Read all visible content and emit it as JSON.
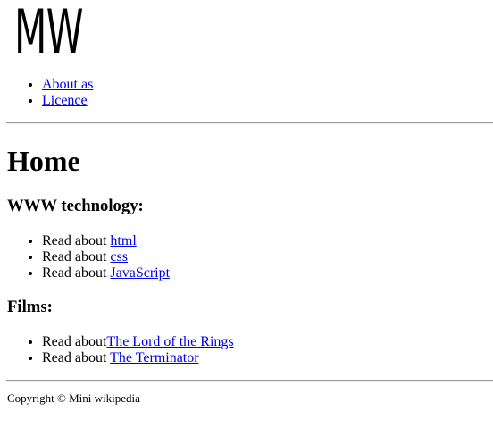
{
  "logo": {
    "text": "MW"
  },
  "nav": {
    "items": [
      {
        "label": "About as"
      },
      {
        "label": "Licence"
      }
    ]
  },
  "main": {
    "title": "Home",
    "sections": [
      {
        "heading": "WWW technology:",
        "items": [
          {
            "prefix": "Read about ",
            "link": "html"
          },
          {
            "prefix": "Read about ",
            "link": "css"
          },
          {
            "prefix": "Read about ",
            "link": "JavaScript"
          }
        ]
      },
      {
        "heading": "Films:",
        "items": [
          {
            "prefix": "Read about",
            "link": "The Lord of the Rings"
          },
          {
            "prefix": "Read about ",
            "link": "The Terminator"
          }
        ]
      }
    ]
  },
  "footer": {
    "text": "Copyright © Mini wikipedia"
  },
  "colors": {
    "link": "#0000ee",
    "text": "#000000",
    "rule": "#9a9a9a"
  }
}
